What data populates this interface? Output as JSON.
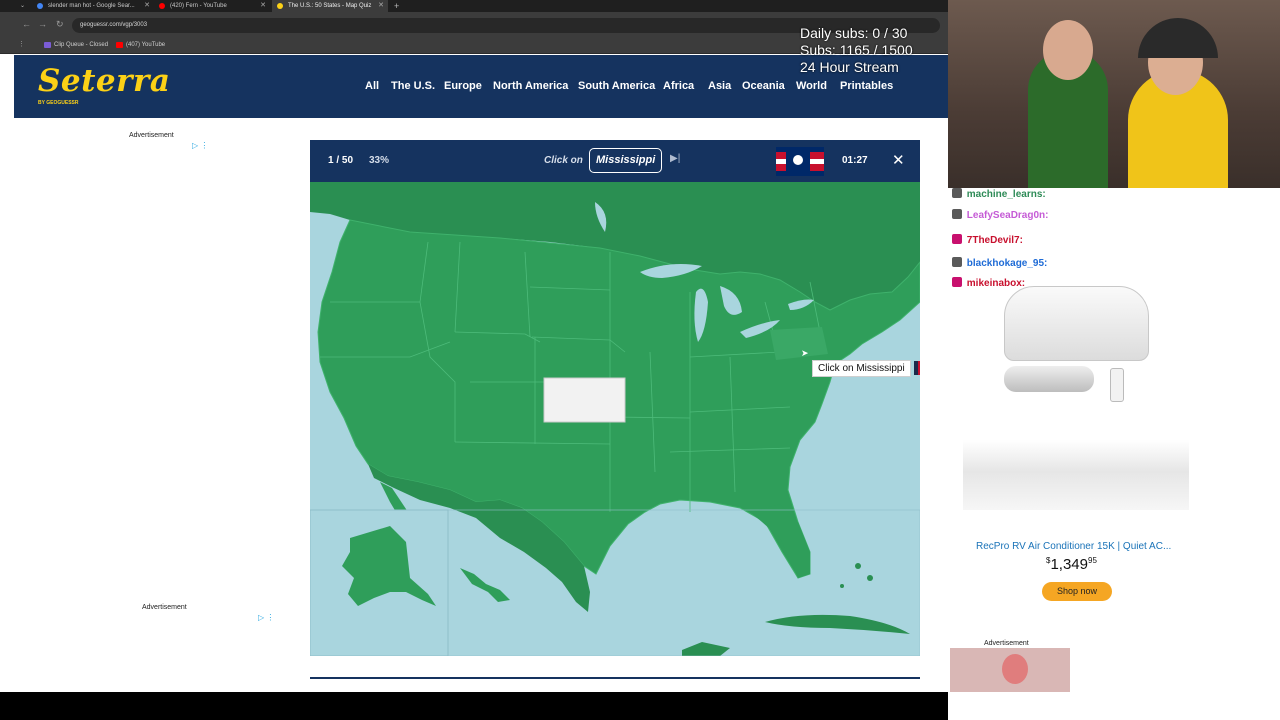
{
  "browser": {
    "tabs": [
      {
        "title": "slender man hot - Google Sear..."
      },
      {
        "title": "(420) Fern - YouTube"
      },
      {
        "title": "The U.S.: 50 States - Map Quiz"
      }
    ],
    "url": "geoguessr.com/vgp/3003",
    "bookmarks": [
      "Clip Queue - Closed",
      "(407) YouTube"
    ]
  },
  "site": {
    "logo": "Seterra",
    "logo_sub": "BY GEOGUESSR",
    "nav": [
      "All",
      "The U.S.",
      "Europe",
      "North America",
      "South America",
      "Africa",
      "Asia",
      "Oceania",
      "World",
      "Printables"
    ]
  },
  "ads": {
    "left_label": "Advertisement",
    "left_label_2": "Advertisement",
    "right_label": "Advertisement"
  },
  "quiz": {
    "progress": "1 / 50",
    "percent": "33%",
    "prompt": "Click on",
    "target": "Mississippi",
    "timer": "01:27",
    "tooltip": "Click on Mississippi",
    "colors": {
      "land": "#2f9e5a",
      "water": "#a9d5de",
      "header": "#15335f",
      "selected": "#f2f2f2"
    }
  },
  "overlay": {
    "line1": "Daily subs: 0 / 30",
    "line2": "Subs: 1165 / 1500",
    "line3": "24 Hour Stream"
  },
  "chat": [
    {
      "user": "machine_learns:",
      "color": "#2e8b57"
    },
    {
      "user": "LeafySeaDrag0n:",
      "color": "#c55bd6"
    },
    {
      "user": "7TheDevil7:",
      "color": "#c8102e"
    },
    {
      "user": "blackhokage_95:",
      "color": "#1e6bd6"
    },
    {
      "user": "mikeinabox:",
      "color": "#c8102e"
    }
  ],
  "product": {
    "title": "RecPro RV Air Conditioner 15K | Quiet AC...",
    "price_dollars": "1,349",
    "price_cents": "95",
    "currency": "$",
    "button": "Shop now"
  }
}
